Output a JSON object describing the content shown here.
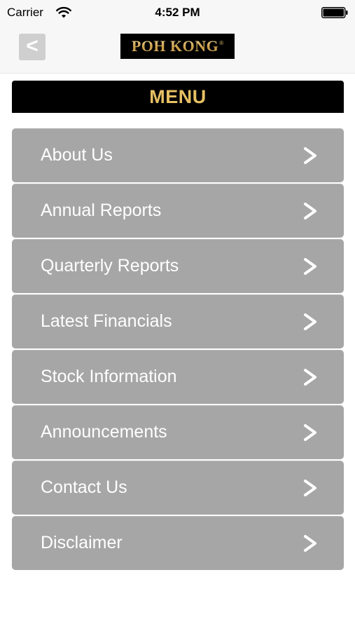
{
  "status_bar": {
    "carrier": "Carrier",
    "time": "4:52 PM",
    "wifi_icon": "wifi-icon",
    "battery_icon": "battery-icon"
  },
  "nav_bar": {
    "back_label": "<",
    "logo_text": "POH KONG",
    "logo_mark": "®"
  },
  "menu": {
    "title": "MENU",
    "items": [
      {
        "label": "About Us"
      },
      {
        "label": "Annual Reports"
      },
      {
        "label": "Quarterly Reports"
      },
      {
        "label": "Latest Financials"
      },
      {
        "label": "Stock Information"
      },
      {
        "label": "Announcements"
      },
      {
        "label": "Contact Us"
      },
      {
        "label": "Disclaimer"
      }
    ],
    "chevron_icon": "chevron-right-icon"
  },
  "colors": {
    "menu_item_bg": "#a6a6a6",
    "menu_header_bg": "#000000",
    "menu_header_text": "#e6c063",
    "logo_gold": "#d4b26a"
  }
}
